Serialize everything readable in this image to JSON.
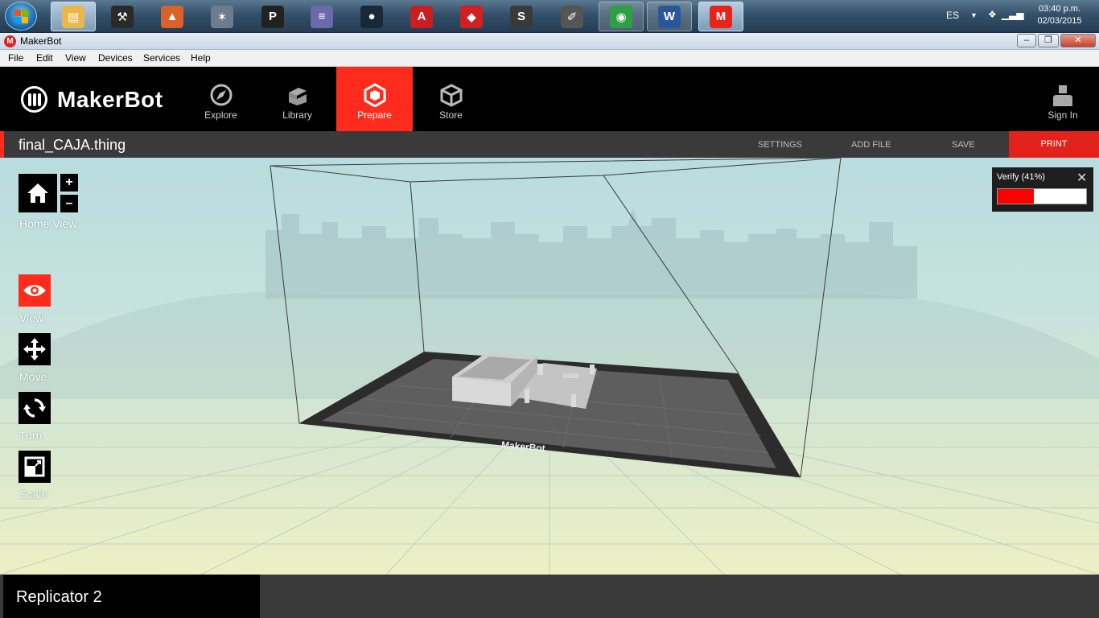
{
  "taskbar": {
    "apps": [
      {
        "name": "file-explorer",
        "state": "active",
        "color": "#e8b84a",
        "glyph": "▤"
      },
      {
        "name": "app-pro",
        "state": "none",
        "color": "#2a2a2a",
        "glyph": "⚒"
      },
      {
        "name": "matlab",
        "state": "none",
        "color": "#d8622a",
        "glyph": "▲"
      },
      {
        "name": "app-x",
        "state": "none",
        "color": "#6c7c8c",
        "glyph": "✶"
      },
      {
        "name": "app-p",
        "state": "none",
        "color": "#222222",
        "glyph": "P"
      },
      {
        "name": "app-mixer",
        "state": "none",
        "color": "#6a6aa8",
        "glyph": "≡"
      },
      {
        "name": "steam",
        "state": "none",
        "color": "#1b2838",
        "glyph": "●"
      },
      {
        "name": "autocad",
        "state": "none",
        "color": "#c82020",
        "glyph": "A"
      },
      {
        "name": "mplab-ide",
        "state": "none",
        "color": "#d02020",
        "glyph": "◆"
      },
      {
        "name": "sublime",
        "state": "none",
        "color": "#3a3a3a",
        "glyph": "S"
      },
      {
        "name": "inkscape",
        "state": "none",
        "color": "#555555",
        "glyph": "✐"
      },
      {
        "name": "chrome",
        "state": "open",
        "color": "#2f9e44",
        "glyph": "◉"
      },
      {
        "name": "word",
        "state": "open",
        "color": "#2b579a",
        "glyph": "W"
      },
      {
        "name": "makerbot",
        "state": "active",
        "color": "#e8231a",
        "glyph": "M"
      }
    ],
    "lang": "ES",
    "time": "03:40 p.m.",
    "date": "02/03/2015"
  },
  "window": {
    "title": "MakerBot"
  },
  "menu": [
    "File",
    "Edit",
    "View",
    "Devices",
    "Services",
    "Help"
  ],
  "header": {
    "logo_text": "MakerBot",
    "tabs": [
      {
        "key": "explore",
        "label": "Explore",
        "icon": "compass-icon",
        "active": false
      },
      {
        "key": "library",
        "label": "Library",
        "icon": "library-icon",
        "active": false
      },
      {
        "key": "prepare",
        "label": "Prepare",
        "icon": "prepare-icon",
        "active": true
      },
      {
        "key": "store",
        "label": "Store",
        "icon": "store-icon",
        "active": false
      }
    ],
    "sign_in": "Sign In"
  },
  "filebar": {
    "file_name": "final_CAJA.thing",
    "settings": "SETTINGS",
    "add_file": "ADD FILE",
    "save": "SAVE",
    "print": "PRINT"
  },
  "tools": {
    "home_view": "Home View",
    "zoom_in": "+",
    "zoom_out": "–",
    "items": [
      {
        "key": "view",
        "label": "View",
        "active": true
      },
      {
        "key": "move",
        "label": "Move",
        "active": false
      },
      {
        "key": "turn",
        "label": "Turn",
        "active": false
      },
      {
        "key": "scale",
        "label": "Scale",
        "active": false
      }
    ]
  },
  "verify": {
    "label": "Verify (41%)",
    "progress": 0.41
  },
  "plate": {
    "brand": "MakerBot"
  },
  "bottom": {
    "printer": "Replicator 2"
  },
  "colors": {
    "accent": "#ff2b1c",
    "print": "#e3231b",
    "progress": "#ff0000"
  }
}
